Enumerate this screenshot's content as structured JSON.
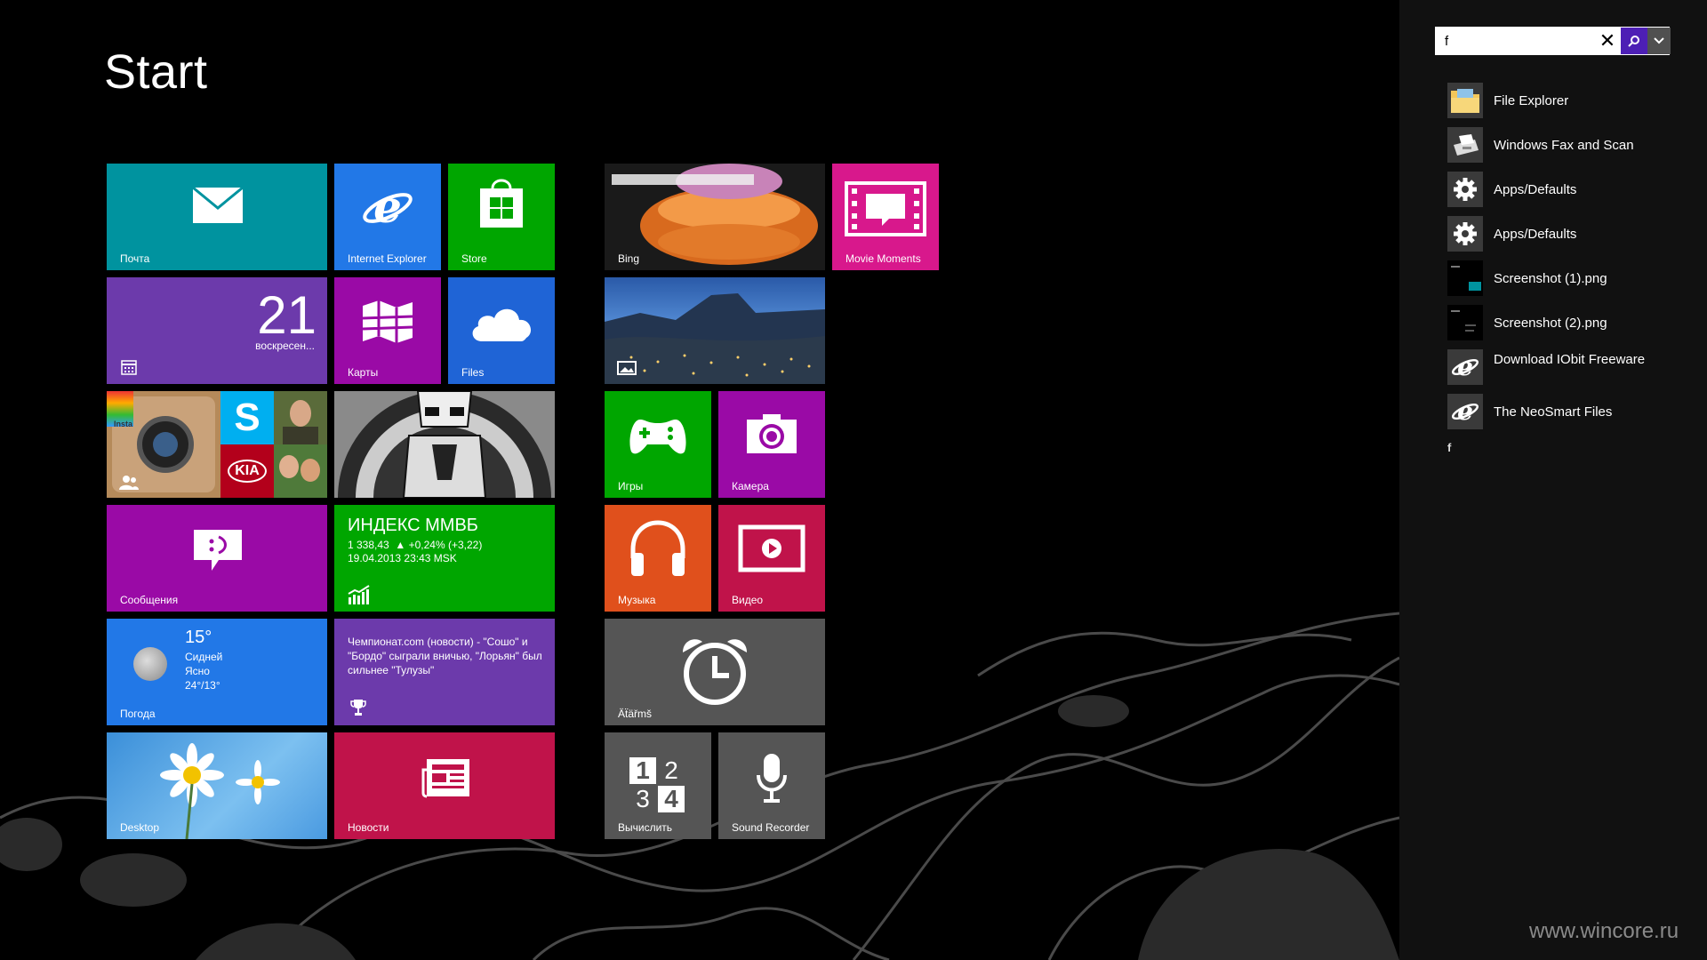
{
  "screen": {
    "title": "Start"
  },
  "colors": {
    "teal": "#00939f",
    "blue": "#2278e7",
    "green": "#00a600",
    "purple": "#6c3aab",
    "magenta": "#9a0aa6",
    "cobalt": "#1f64d6",
    "pink": "#d8188c",
    "orange": "#e0501c",
    "crimson": "#c0134a",
    "gray": "#555555",
    "accent": "#4d1fb5"
  },
  "tiles": {
    "mail": {
      "label": "Почта",
      "icon": "envelope-icon"
    },
    "ie": {
      "label": "Internet Explorer",
      "icon": "internet-explorer-icon"
    },
    "store": {
      "label": "Store",
      "icon": "store-bag-icon"
    },
    "calendar": {
      "day": "21",
      "weekday": "воскресен...",
      "icon": "calendar-icon"
    },
    "maps": {
      "label": "Карты",
      "icon": "map-icon"
    },
    "files": {
      "label": "Files",
      "icon": "cloud-icon"
    },
    "people": {
      "icon": "people-icon",
      "photo_labels": {
        "instagram": "Insta",
        "skype": "S",
        "kia": "KIA"
      }
    },
    "photo_art": {
      "icon": "stormtrooper-art"
    },
    "messaging": {
      "label": "Сообщения",
      "icon": "chat-bubble-icon"
    },
    "finance": {
      "title": "ИНДЕКС ММВБ",
      "value": "1 338,43  ▲ +0,24% (+3,22)",
      "time": "19.04.2013 23:43 MSK",
      "icon": "chart-growth-icon"
    },
    "weather": {
      "label": "Погода",
      "temp": "15°",
      "city": "Сидней",
      "condition": "Ясно",
      "range": "24°/13°",
      "icon": "moon-icon"
    },
    "sports": {
      "headline": "Чемпионат.com  (новости) - \"Сошо\" и \"Бордо\" сыграли вничью, \"Лорьян\" был сильнее \"Тулузы\"",
      "icon": "trophy-icon"
    },
    "desktop": {
      "label": "Desktop"
    },
    "news": {
      "label": "Новости",
      "icon": "newspaper-icon"
    },
    "bing": {
      "label": "Bing"
    },
    "movie": {
      "label": "Movie Moments",
      "icon": "film-icon"
    },
    "photos": {
      "icon": "photos-icon"
    },
    "games": {
      "label": "Игры",
      "icon": "gamepad-icon"
    },
    "camera": {
      "label": "Камера",
      "icon": "camera-icon"
    },
    "music": {
      "label": "Музыка",
      "icon": "headphones-icon"
    },
    "video": {
      "label": "Видео",
      "icon": "play-icon"
    },
    "alarms": {
      "label": "Äẗäřmš",
      "icon": "alarm-clock-icon"
    },
    "calculator": {
      "label": "Вычислить",
      "icon": "calculator-icon",
      "digits": [
        "1",
        "2",
        "3",
        "4"
      ]
    },
    "recorder": {
      "label": "Sound Recorder",
      "icon": "microphone-icon"
    }
  },
  "search": {
    "query": "f",
    "placeholder": "",
    "results": [
      {
        "label": "File Explorer",
        "icon": "folder-icon"
      },
      {
        "label": "Windows Fax and Scan",
        "icon": "fax-icon"
      },
      {
        "label": "Apps/Defaults",
        "icon": "gear-icon"
      },
      {
        "label": "Apps/Defaults",
        "icon": "gear-icon"
      },
      {
        "label": "Screenshot (1).png",
        "icon": "image-thumbnail-icon"
      },
      {
        "label": "Screenshot (2).png",
        "icon": "image-thumbnail-icon"
      },
      {
        "label": "Download IObit Freeware",
        "icon": "internet-explorer-icon"
      },
      {
        "label": "The NeoSmart Files",
        "icon": "internet-explorer-icon"
      }
    ],
    "more": "f"
  },
  "watermark": "www.wincore.ru"
}
